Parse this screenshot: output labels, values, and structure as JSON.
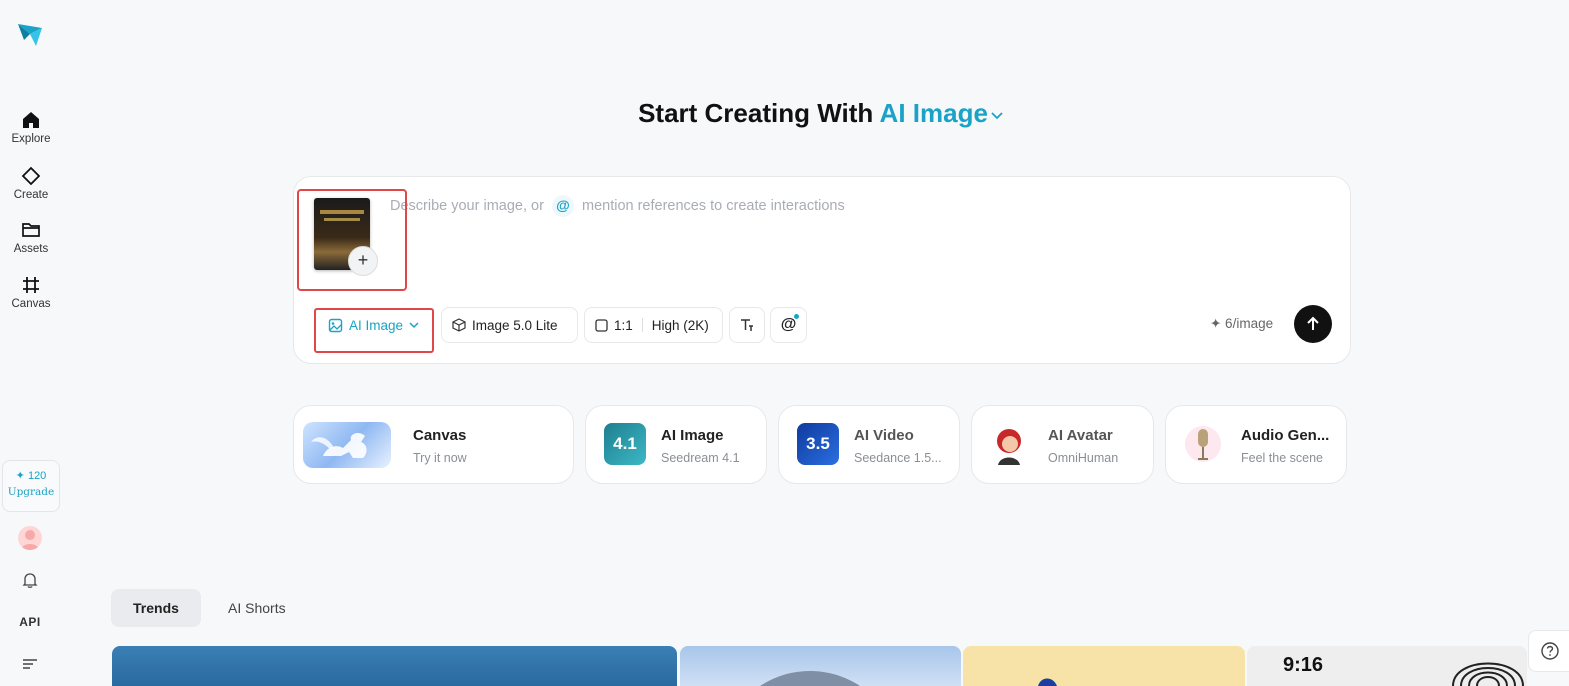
{
  "sidebar": {
    "items": [
      {
        "label": "Explore",
        "icon": "home-icon"
      },
      {
        "label": "Create",
        "icon": "diamond-icon"
      },
      {
        "label": "Assets",
        "icon": "folder-icon"
      },
      {
        "label": "Canvas",
        "icon": "canvas-grid-icon"
      }
    ],
    "credits": "✦ 120",
    "upgrade_label": "Upgrade",
    "api_label": "API"
  },
  "headline": {
    "prefix": "Start Creating With",
    "accent": "AI Image"
  },
  "prompt": {
    "placeholder_part1": "Describe your image, or",
    "at_symbol": "@",
    "placeholder_part2": "mention references to create interactions",
    "add_reference": "+"
  },
  "toolbar": {
    "mode_label": "AI Image",
    "model_label": "Image 5.0 Lite",
    "ratio_label": "1:1",
    "quality_label": "High (2K)",
    "at_label": "@",
    "cost_label": "✦ 6/image"
  },
  "features": [
    {
      "title": "Canvas",
      "subtitle": "Try it now"
    },
    {
      "title": "AI Image",
      "subtitle": "Seedream 4.1",
      "badge": "4.1"
    },
    {
      "title": "AI Video",
      "subtitle": "Seedance 1.5...",
      "badge": "3.5"
    },
    {
      "title": "AI Avatar",
      "subtitle": "OmniHuman"
    },
    {
      "title": "Audio Gen...",
      "subtitle": "Feel the scene"
    }
  ],
  "tabs": [
    {
      "label": "Trends",
      "active": true
    },
    {
      "label": "AI Shorts",
      "active": false
    }
  ],
  "gallery": {
    "ratio_label": "9:16"
  },
  "colors": {
    "accent": "#1aa3c6",
    "highlight": "#e04848",
    "background": "#f7f8fa"
  }
}
